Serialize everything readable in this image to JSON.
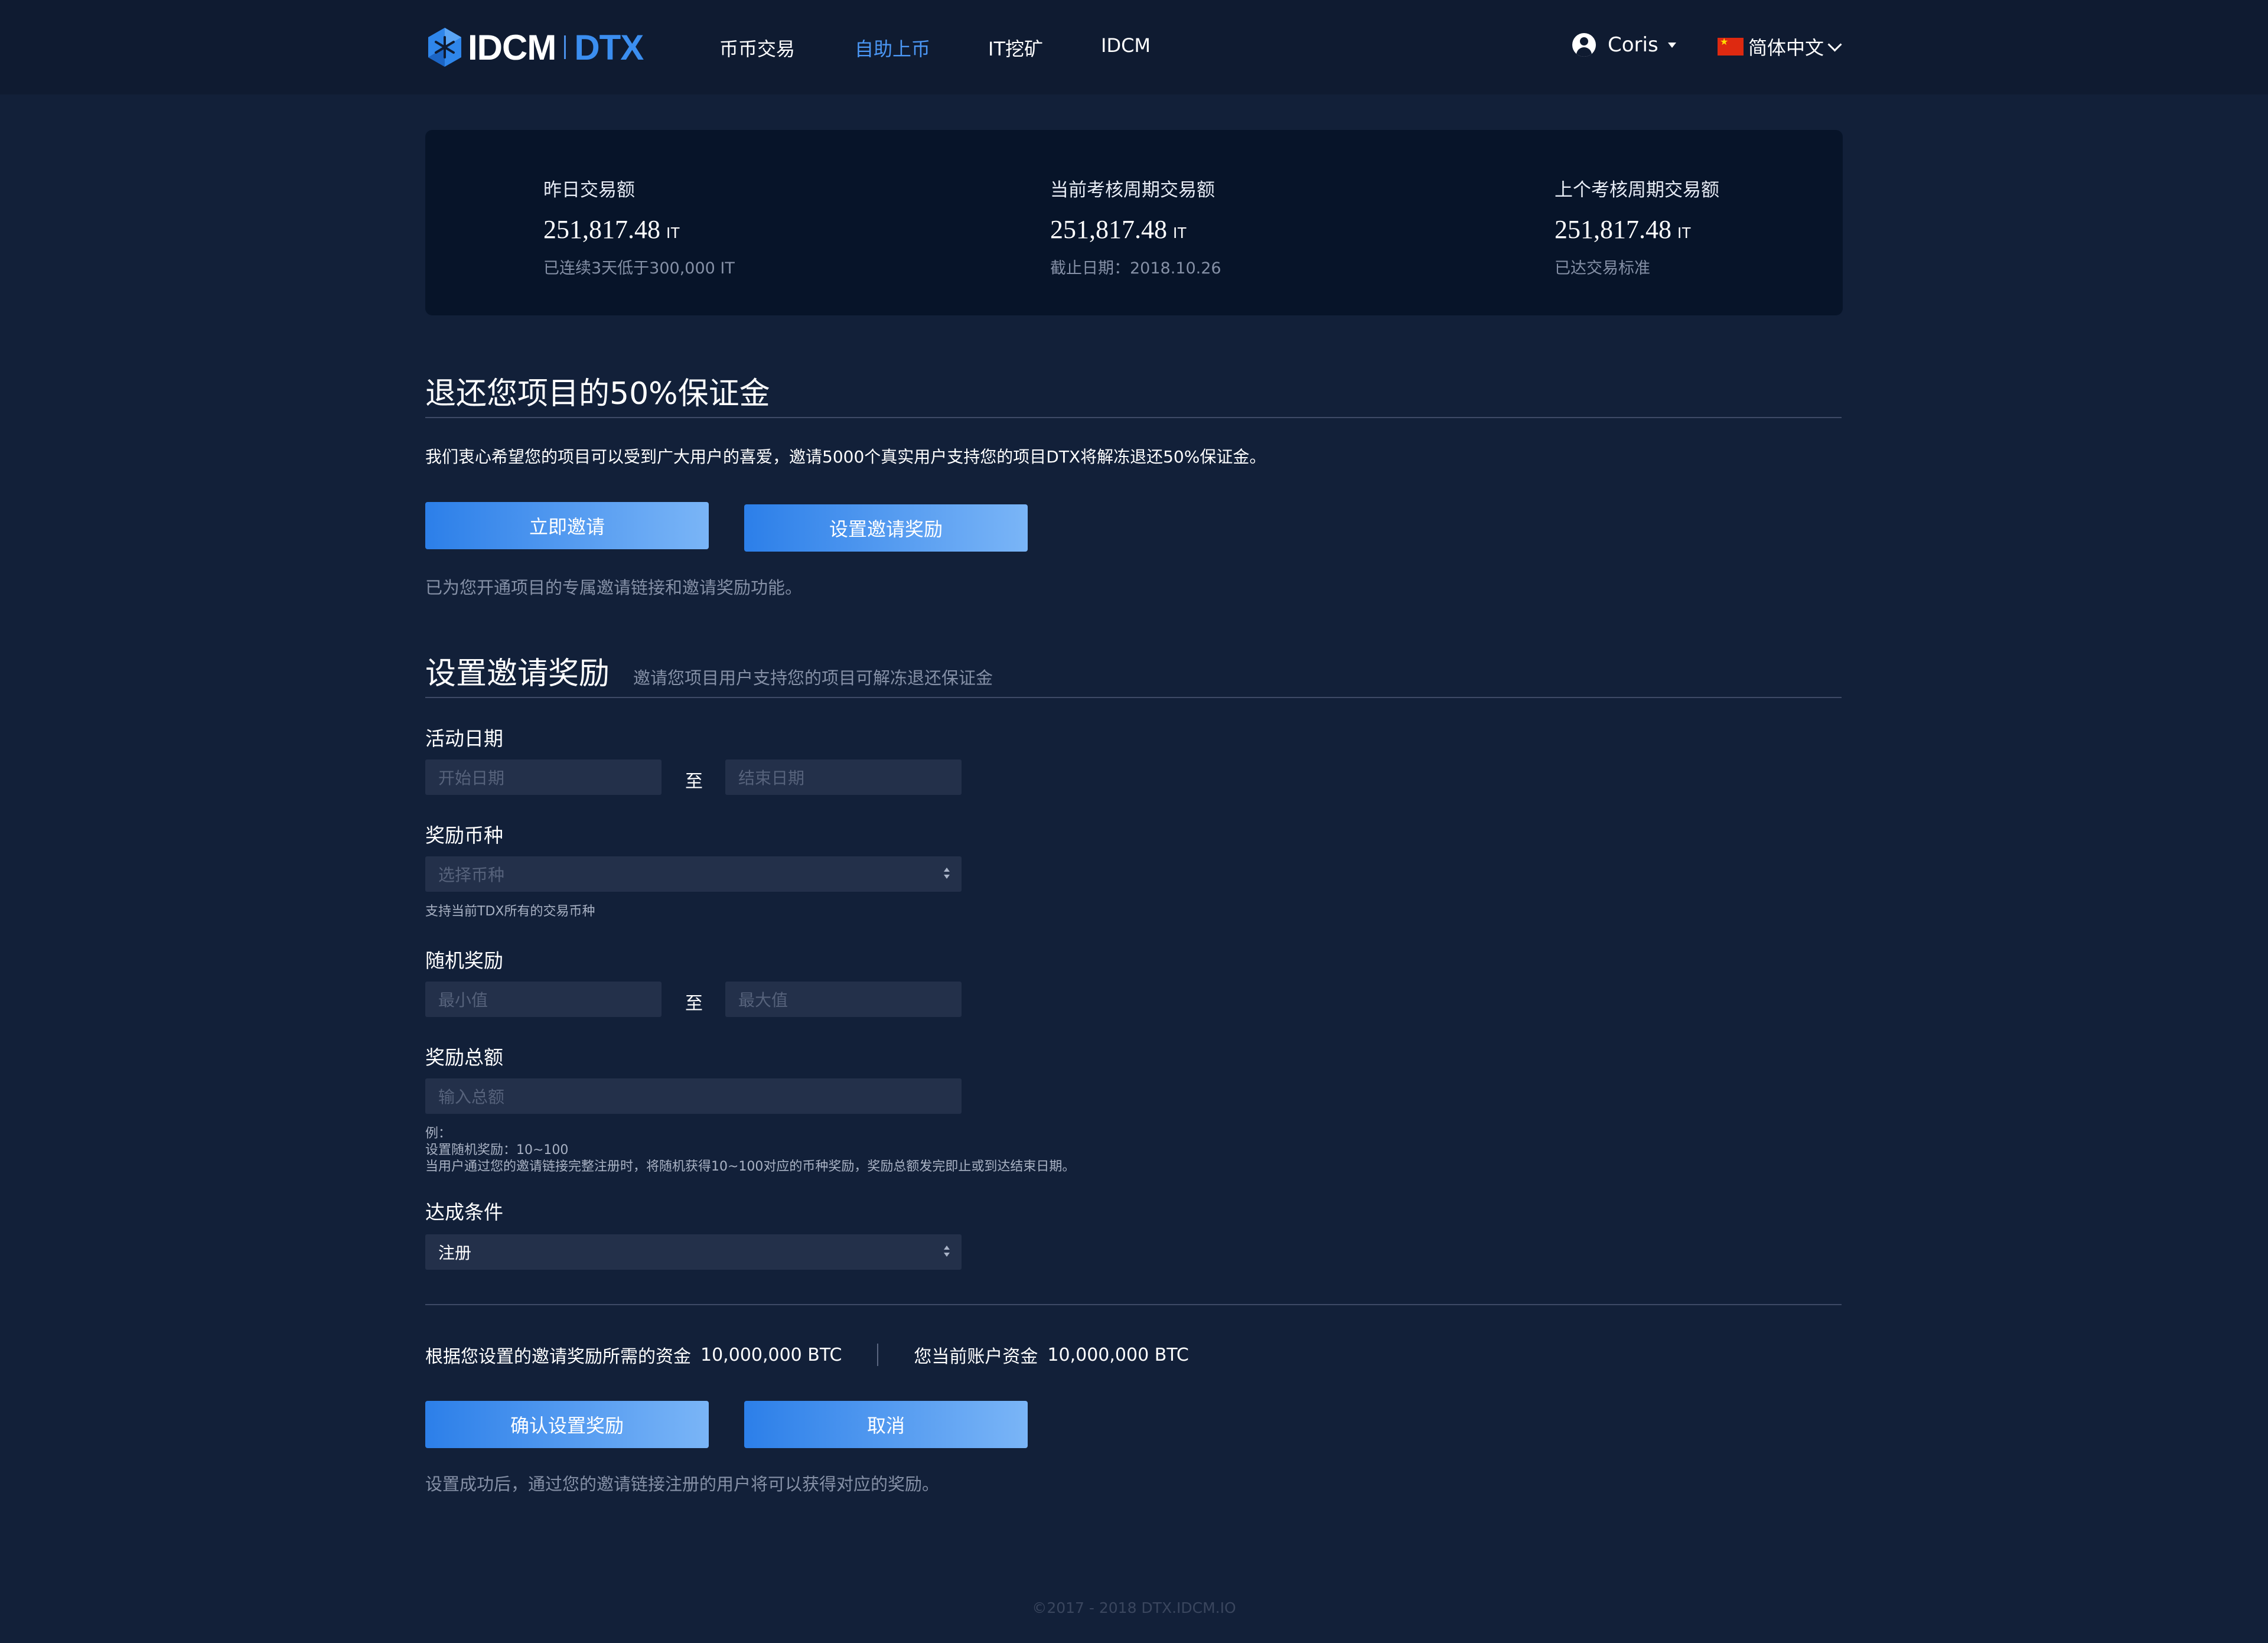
{
  "header": {
    "logo": {
      "brand": "IDCM",
      "product": "DTX"
    },
    "nav": [
      {
        "label": "币币交易",
        "active": false
      },
      {
        "label": "自助上币",
        "active": true
      },
      {
        "label": "IT挖矿",
        "active": false
      },
      {
        "label": "IDCM",
        "active": false
      }
    ],
    "user": {
      "name": "Coris",
      "icon": "user-avatar-icon"
    },
    "language": {
      "label": "简体中文",
      "flag": "cn-flag-icon"
    }
  },
  "stats": [
    {
      "label": "昨日交易额",
      "value": "251,817.48",
      "unit": "IT",
      "note": "已连续3天低于300,000 IT"
    },
    {
      "label": "当前考核周期交易额",
      "value": "251,817.48",
      "unit": "IT",
      "note": "截止日期：2018.10.26"
    },
    {
      "label": "上个考核周期交易额",
      "value": "251,817.48",
      "unit": "IT",
      "note": "已达交易标准"
    }
  ],
  "refund": {
    "title": "退还您项目的50%保证金",
    "description": "我们衷心希望您的项目可以受到广大用户的喜爱，邀请5000个真实用户支持您的项目DTX将解冻退还50%保证金。",
    "invite_button": "立即邀请",
    "set_reward_button": "设置邀请奖励",
    "note": "已为您开通项目的专属邀请链接和邀请奖励功能。"
  },
  "reward_form": {
    "title": "设置邀请奖励",
    "subtitle": "邀请您项目用户支持您的项目可解冻退还保证金",
    "date": {
      "label": "活动日期",
      "start_placeholder": "开始日期",
      "to": "至",
      "end_placeholder": "结束日期"
    },
    "currency": {
      "label": "奖励币种",
      "placeholder": "选择币种",
      "hint": "支持当前TDX所有的交易币种"
    },
    "random": {
      "label": "随机奖励",
      "min_placeholder": "最小值",
      "to": "至",
      "max_placeholder": "最大值"
    },
    "total": {
      "label": "奖励总额",
      "placeholder": "输入总额",
      "hint_lines": [
        "例：",
        "设置随机奖励：10~100",
        "当用户通过您的邀请链接完整注册时，将随机获得10~100对应的币种奖励，奖励总额发完即止或到达结束日期。"
      ]
    },
    "condition": {
      "label": "达成条件",
      "value": "注册"
    }
  },
  "summary": {
    "required_label": "根据您设置的邀请奖励所需的资金",
    "required_value": "10,000,000 BTC",
    "balance_label": "您当前账户资金",
    "balance_value": "10,000,000 BTC"
  },
  "actions": {
    "confirm": "确认设置奖励",
    "cancel": "取消",
    "note": "设置成功后，通过您的邀请链接注册的用户将可以获得对应的奖励。"
  },
  "footer": {
    "copyright": "©2017 - 2018 DTX.IDCM.IO"
  },
  "colors": {
    "background": "#122039",
    "header": "#0f1b31",
    "card": "#071429",
    "accent": "#3b8ef0",
    "input": "#23304a"
  }
}
